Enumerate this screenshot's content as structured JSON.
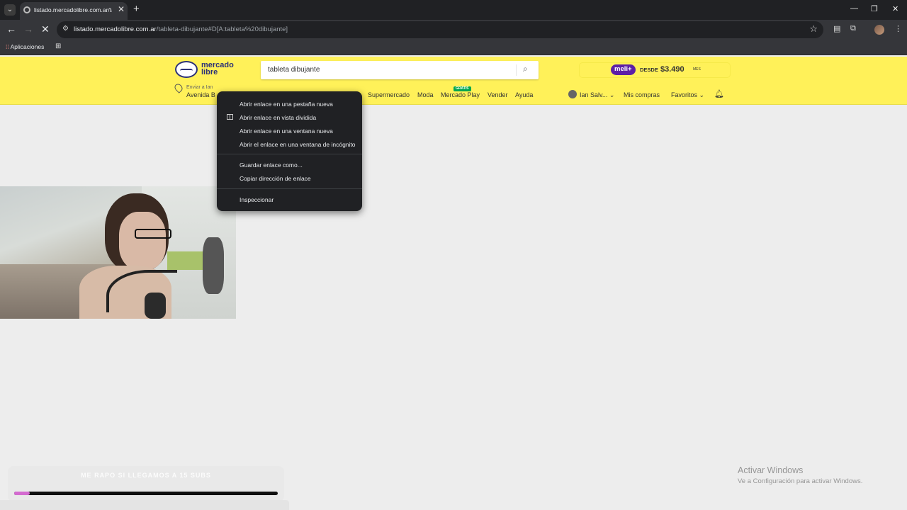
{
  "browser": {
    "tab_title": "listado.mercadolibre.com.ar/tab",
    "url_host": "listado.mercadolibre.com.ar",
    "url_path": "/tableta-dibujante#D[A:tableta%20dibujante]",
    "bookmarks": {
      "apps_label": "Aplicaciones"
    }
  },
  "ml": {
    "logo_line1": "mercado",
    "logo_line2": "libre",
    "search_value": "tableta dibujante",
    "meli_badge": "meli+",
    "meli_desde": "DESDE",
    "meli_price": "$3.490",
    "meli_mes": "MES",
    "location_line1": "Enviar a Ian",
    "location_line2": "Avenida B",
    "nav": [
      "Supermercado",
      "Moda",
      "Mercado Play",
      "Vender",
      "Ayuda"
    ],
    "gratis_badge": "GRATIS",
    "user_name": "Ian Salv...",
    "mis_compras": "Mis compras",
    "favoritos": "Favoritos"
  },
  "context_menu": {
    "items": [
      "Abrir enlace en una pestaña nueva",
      "Abrir enlace en vista dividida",
      "Abrir enlace en una ventana nueva",
      "Abrir el enlace en una ventana de incógnito",
      "Guardar enlace como...",
      "Copiar dirección de enlace",
      "Inspeccionar"
    ]
  },
  "stream_goal": {
    "title": "ME RAPO SI LLEGAMOS A 15 SUBS",
    "progress": 0.06,
    "fill_color": "#d46bd0"
  },
  "watermark": {
    "title": "Activar Windows",
    "subtitle": "Ve a Configuración para activar Windows."
  },
  "colors": {
    "ml_yellow": "#fff159",
    "ml_blue": "#2d3277",
    "meli_purple": "#5d1fa6",
    "chrome_dark": "#202124"
  }
}
